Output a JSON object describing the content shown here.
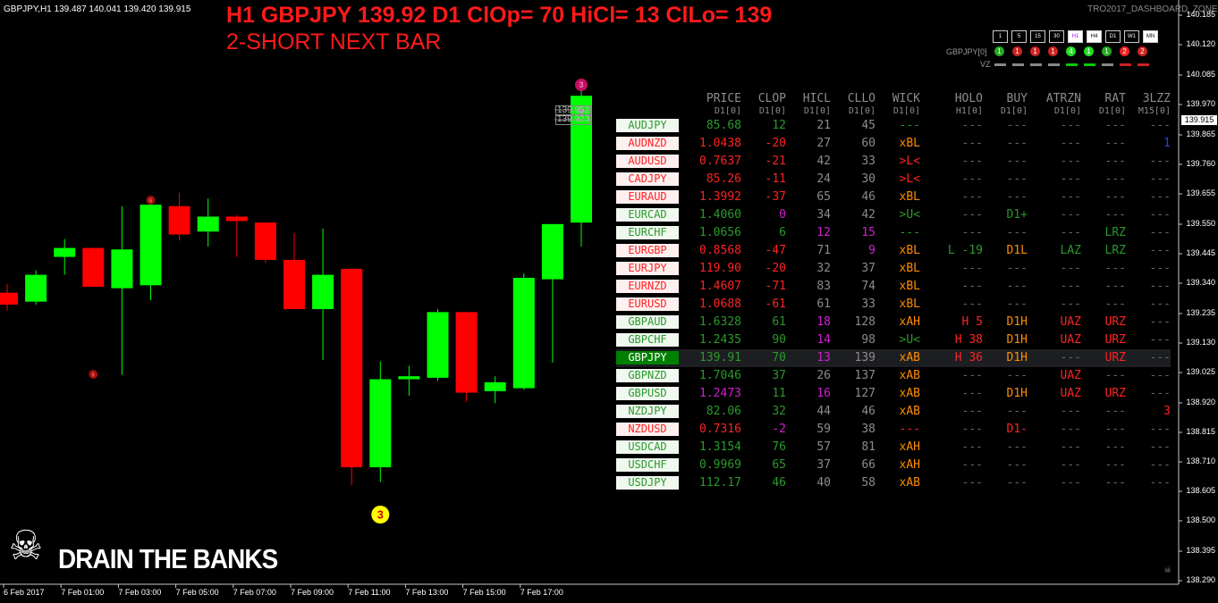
{
  "header": {
    "symbol_line": "GBPJPY,H1  139.487 140.041 139.420 139.915",
    "signal_line_1": "H1 GBPJPY 139.92  D1 ClOp= 70 HiCl= 13 ClLo= 139",
    "signal_line_2": "2-SHORT NEXT BAR",
    "dashboard_name": "TRO2017_DASHBOARD_ZONES"
  },
  "timeframes": [
    {
      "label": "1",
      "state": "normal"
    },
    {
      "label": "5",
      "state": "normal"
    },
    {
      "label": "15",
      "state": "normal"
    },
    {
      "label": "30",
      "state": "normal"
    },
    {
      "label": "H1",
      "state": "highlight"
    },
    {
      "label": "H4",
      "state": "active"
    },
    {
      "label": "D1",
      "state": "normal"
    },
    {
      "label": "W1",
      "state": "normal"
    },
    {
      "label": "MN",
      "state": "active"
    }
  ],
  "indicator_row": {
    "label": "GBPJPY[0]",
    "dots": [
      {
        "text": "1",
        "color": "#22aa22"
      },
      {
        "text": "1",
        "color": "#cc2222"
      },
      {
        "text": "1",
        "color": "#cc2222"
      },
      {
        "text": "1",
        "color": "#cc2222"
      },
      {
        "text": "4",
        "color": "#22dd22"
      },
      {
        "text": "1",
        "color": "#22dd22"
      },
      {
        "text": "1",
        "color": "#22aa22"
      },
      {
        "text": "2",
        "color": "#ee2222"
      },
      {
        "text": "2",
        "color": "#cc2222"
      }
    ]
  },
  "vz_row": {
    "label": "VZ",
    "bars": [
      "#888888",
      "#888888",
      "#888888",
      "#888888",
      "#00cc00",
      "#00cc00",
      "#888888",
      "#cc2222",
      "#cc2222"
    ]
  },
  "table": {
    "columns": [
      {
        "title": "PRICE",
        "sub": "D1[0]"
      },
      {
        "title": "CLOP",
        "sub": "D1[0]"
      },
      {
        "title": "HICL",
        "sub": "D1[0]"
      },
      {
        "title": "CLLO",
        "sub": "D1[0]"
      },
      {
        "title": "WICK",
        "sub": "D1[0]"
      },
      {
        "title": "HOLO",
        "sub": "H1[0]"
      },
      {
        "title": "BUY",
        "sub": "D1[0]"
      },
      {
        "title": "ATRZN",
        "sub": "D1[0]"
      },
      {
        "title": "RAT",
        "sub": "D1[0]"
      },
      {
        "title": "3LZZ",
        "sub": "M15[0]"
      }
    ],
    "rows": [
      {
        "sym": "AUDJPY",
        "dir": "up",
        "price": "85.68",
        "clop": "12",
        "hicl": "21",
        "cllo": "45",
        "wick": "---",
        "holo": "---",
        "buy": "---",
        "atrzn": "---",
        "rat": "---",
        "lzz": "---",
        "c": {
          "price": "#2a9a2a",
          "clop": "#2a9a2a",
          "hicl": "#8c8c8c",
          "cllo": "#8c8c8c",
          "wick": "#2a9a2a",
          "lzz": "#666"
        }
      },
      {
        "sym": "AUDNZD",
        "dir": "down",
        "price": "1.0438",
        "clop": "-20",
        "hicl": "27",
        "cllo": "60",
        "wick": "xBL",
        "holo": "---",
        "buy": "---",
        "atrzn": "---",
        "rat": "---",
        "lzz": "1",
        "c": {
          "price": "#ff2222",
          "clop": "#ff2222",
          "hicl": "#8c8c8c",
          "cllo": "#8c8c8c",
          "wick": "#ff8c00",
          "lzz": "#2244ff"
        }
      },
      {
        "sym": "AUDUSD",
        "dir": "down",
        "price": "0.7637",
        "clop": "-21",
        "hicl": "42",
        "cllo": "33",
        "wick": ">L<",
        "holo": "---",
        "buy": "---",
        "atrzn": "---",
        "rat": "---",
        "lzz": "---",
        "c": {
          "price": "#ff2222",
          "clop": "#ff2222",
          "hicl": "#8c8c8c",
          "cllo": "#8c8c8c",
          "wick": "#ff2222",
          "lzz": "#666"
        }
      },
      {
        "sym": "CADJPY",
        "dir": "down",
        "price": "85.26",
        "clop": "-11",
        "hicl": "24",
        "cllo": "30",
        "wick": ">L<",
        "holo": "---",
        "buy": "---",
        "atrzn": "---",
        "rat": "---",
        "lzz": "---",
        "c": {
          "price": "#ff2222",
          "clop": "#ff2222",
          "hicl": "#8c8c8c",
          "cllo": "#8c8c8c",
          "wick": "#ff2222",
          "lzz": "#666"
        }
      },
      {
        "sym": "EURAUD",
        "dir": "down",
        "price": "1.3992",
        "clop": "-37",
        "hicl": "65",
        "cllo": "46",
        "wick": "xBL",
        "holo": "---",
        "buy": "---",
        "atrzn": "---",
        "rat": "---",
        "lzz": "---",
        "c": {
          "price": "#ff2222",
          "clop": "#ff2222",
          "hicl": "#8c8c8c",
          "cllo": "#8c8c8c",
          "wick": "#ff8c00",
          "lzz": "#666"
        }
      },
      {
        "sym": "EURCAD",
        "dir": "up",
        "price": "1.4060",
        "clop": "0",
        "hicl": "34",
        "cllo": "42",
        "wick": ">U<",
        "holo": "---",
        "buy": "D1+",
        "atrzn": "---",
        "rat": "---",
        "lzz": "---",
        "c": {
          "price": "#2a9a2a",
          "clop": "#d020d0",
          "hicl": "#8c8c8c",
          "cllo": "#8c8c8c",
          "wick": "#2a9a2a",
          "buy": "#2a9a2a",
          "lzz": "#666"
        }
      },
      {
        "sym": "EURCHF",
        "dir": "up",
        "price": "1.0656",
        "clop": "6",
        "hicl": "12",
        "cllo": "15",
        "wick": "---",
        "holo": "---",
        "buy": "---",
        "atrzn": "---",
        "rat": "LRZ",
        "lzz": "---",
        "c": {
          "price": "#2a9a2a",
          "clop": "#2a9a2a",
          "hicl": "#d020d0",
          "cllo": "#d020d0",
          "wick": "#2a9a2a",
          "rat": "#2a9a2a",
          "lzz": "#666"
        }
      },
      {
        "sym": "EURGBP",
        "dir": "down",
        "price": "0.8568",
        "clop": "-47",
        "hicl": "71",
        "cllo": "9",
        "wick": "xBL",
        "holo": "L -19",
        "buy": "D1L",
        "atrzn": "LAZ",
        "rat": "LRZ",
        "lzz": "---",
        "c": {
          "price": "#ff2222",
          "clop": "#ff2222",
          "hicl": "#8c8c8c",
          "cllo": "#d020d0",
          "wick": "#ff8c00",
          "holo": "#2a9a2a",
          "buy": "#ff8c00",
          "atrzn": "#2a9a2a",
          "rat": "#2a9a2a",
          "lzz": "#666"
        }
      },
      {
        "sym": "EURJPY",
        "dir": "down",
        "price": "119.90",
        "clop": "-20",
        "hicl": "32",
        "cllo": "37",
        "wick": "xBL",
        "holo": "---",
        "buy": "---",
        "atrzn": "---",
        "rat": "---",
        "lzz": "---",
        "c": {
          "price": "#ff2222",
          "clop": "#ff2222",
          "hicl": "#8c8c8c",
          "cllo": "#8c8c8c",
          "wick": "#ff8c00",
          "lzz": "#666"
        }
      },
      {
        "sym": "EURNZD",
        "dir": "down",
        "price": "1.4607",
        "clop": "-71",
        "hicl": "83",
        "cllo": "74",
        "wick": "xBL",
        "holo": "---",
        "buy": "---",
        "atrzn": "---",
        "rat": "---",
        "lzz": "---",
        "c": {
          "price": "#ff2222",
          "clop": "#ff2222",
          "hicl": "#8c8c8c",
          "cllo": "#8c8c8c",
          "wick": "#ff8c00",
          "lzz": "#666"
        }
      },
      {
        "sym": "EURUSD",
        "dir": "down",
        "price": "1.0688",
        "clop": "-61",
        "hicl": "61",
        "cllo": "33",
        "wick": "xBL",
        "holo": "---",
        "buy": "---",
        "atrzn": "---",
        "rat": "---",
        "lzz": "---",
        "c": {
          "price": "#ff2222",
          "clop": "#ff2222",
          "hicl": "#8c8c8c",
          "cllo": "#8c8c8c",
          "wick": "#ff8c00",
          "lzz": "#666"
        }
      },
      {
        "sym": "GBPAUD",
        "dir": "up",
        "price": "1.6328",
        "clop": "61",
        "hicl": "18",
        "cllo": "128",
        "wick": "xAH",
        "holo": "H 5",
        "buy": "D1H",
        "atrzn": "UAZ",
        "rat": "URZ",
        "lzz": "---",
        "c": {
          "price": "#2a9a2a",
          "clop": "#2a9a2a",
          "hicl": "#d020d0",
          "cllo": "#8c8c8c",
          "wick": "#ff8c00",
          "holo": "#ff2222",
          "buy": "#ff8c00",
          "atrzn": "#ff2222",
          "rat": "#ff2222",
          "lzz": "#666"
        }
      },
      {
        "sym": "GBPCHF",
        "dir": "up",
        "price": "1.2435",
        "clop": "90",
        "hicl": "14",
        "cllo": "98",
        "wick": ">U<",
        "holo": "H 38",
        "buy": "D1H",
        "atrzn": "UAZ",
        "rat": "URZ",
        "lzz": "---",
        "c": {
          "price": "#2a9a2a",
          "clop": "#2a9a2a",
          "hicl": "#d020d0",
          "cllo": "#8c8c8c",
          "wick": "#2a9a2a",
          "holo": "#ff2222",
          "buy": "#ff8c00",
          "atrzn": "#ff2222",
          "rat": "#ff2222",
          "lzz": "#666"
        }
      },
      {
        "sym": "GBPJPY",
        "dir": "sel",
        "price": "139.91",
        "clop": "70",
        "hicl": "13",
        "cllo": "139",
        "wick": "xAB",
        "holo": "H 36",
        "buy": "D1H",
        "atrzn": "---",
        "rat": "URZ",
        "lzz": "---",
        "c": {
          "price": "#2a9a2a",
          "clop": "#2a9a2a",
          "hicl": "#d020d0",
          "cllo": "#8c8c8c",
          "wick": "#ff8c00",
          "holo": "#ff2222",
          "buy": "#ff8c00",
          "atrzn": "#666",
          "rat": "#ff2222",
          "lzz": "#666"
        }
      },
      {
        "sym": "GBPNZD",
        "dir": "up",
        "price": "1.7046",
        "clop": "37",
        "hicl": "26",
        "cllo": "137",
        "wick": "xAB",
        "holo": "---",
        "buy": "---",
        "atrzn": "UAZ",
        "rat": "---",
        "lzz": "---",
        "c": {
          "price": "#2a9a2a",
          "clop": "#2a9a2a",
          "hicl": "#8c8c8c",
          "cllo": "#8c8c8c",
          "wick": "#ff8c00",
          "atrzn": "#ff2222",
          "lzz": "#666"
        }
      },
      {
        "sym": "GBPUSD",
        "dir": "up",
        "price": "1.2473",
        "clop": "11",
        "hicl": "16",
        "cllo": "127",
        "wick": "xAB",
        "holo": "---",
        "buy": "D1H",
        "atrzn": "UAZ",
        "rat": "URZ",
        "lzz": "---",
        "c": {
          "price": "#d020d0",
          "clop": "#2a9a2a",
          "hicl": "#d020d0",
          "cllo": "#8c8c8c",
          "wick": "#ff8c00",
          "buy": "#ff8c00",
          "atrzn": "#ff2222",
          "rat": "#ff2222",
          "lzz": "#666"
        }
      },
      {
        "sym": "NZDJPY",
        "dir": "up",
        "price": "82.06",
        "clop": "32",
        "hicl": "44",
        "cllo": "46",
        "wick": "xAB",
        "holo": "---",
        "buy": "---",
        "atrzn": "---",
        "rat": "---",
        "lzz": "3",
        "c": {
          "price": "#2a9a2a",
          "clop": "#2a9a2a",
          "hicl": "#8c8c8c",
          "cllo": "#8c8c8c",
          "wick": "#ff8c00",
          "lzz": "#ff2222"
        }
      },
      {
        "sym": "NZDUSD",
        "dir": "down",
        "price": "0.7316",
        "clop": "-2",
        "hicl": "59",
        "cllo": "38",
        "wick": "---",
        "holo": "---",
        "buy": "D1-",
        "atrzn": "---",
        "rat": "---",
        "lzz": "---",
        "c": {
          "price": "#ff2222",
          "clop": "#d020d0",
          "hicl": "#8c8c8c",
          "cllo": "#8c8c8c",
          "wick": "#ff2222",
          "buy": "#ff2222",
          "lzz": "#666"
        }
      },
      {
        "sym": "USDCAD",
        "dir": "up",
        "price": "1.3154",
        "clop": "76",
        "hicl": "57",
        "cllo": "81",
        "wick": "xAH",
        "holo": "---",
        "buy": "---",
        "atrzn": "---",
        "rat": "---",
        "lzz": "---",
        "c": {
          "price": "#2a9a2a",
          "clop": "#2a9a2a",
          "hicl": "#8c8c8c",
          "cllo": "#8c8c8c",
          "wick": "#ff8c00",
          "lzz": "#666"
        }
      },
      {
        "sym": "USDCHF",
        "dir": "up",
        "price": "0.9969",
        "clop": "65",
        "hicl": "37",
        "cllo": "66",
        "wick": "xAH",
        "holo": "---",
        "buy": "---",
        "atrzn": "---",
        "rat": "---",
        "lzz": "---",
        "c": {
          "price": "#2a9a2a",
          "clop": "#2a9a2a",
          "hicl": "#8c8c8c",
          "cllo": "#8c8c8c",
          "wick": "#ff8c00",
          "lzz": "#666"
        }
      },
      {
        "sym": "USDJPY",
        "dir": "up",
        "price": "112.17",
        "clop": "46",
        "hicl": "40",
        "cllo": "58",
        "wick": "xAB",
        "holo": "---",
        "buy": "---",
        "atrzn": "---",
        "rat": "---",
        "lzz": "---",
        "c": {
          "price": "#2a9a2a",
          "clop": "#2a9a2a",
          "hicl": "#8c8c8c",
          "cllo": "#8c8c8c",
          "wick": "#ff8c00",
          "lzz": "#666"
        }
      }
    ]
  },
  "price_axis": {
    "labels": [
      "140.185",
      "140.120",
      "140.085",
      "139.970",
      "139.915",
      "139.865",
      "139.760",
      "139.655",
      "139.550",
      "139.445",
      "139.340",
      "139.235",
      "139.130",
      "139.025",
      "138.920",
      "138.815",
      "138.710",
      "138.605",
      "138.500",
      "138.395",
      "138.290"
    ],
    "current": "139.915"
  },
  "time_axis": {
    "labels": [
      "6 Feb 2017",
      "7 Feb 01:00",
      "7 Feb 03:00",
      "7 Feb 05:00",
      "7 Feb 07:00",
      "7 Feb 09:00",
      "7 Feb 11:00",
      "7 Feb 13:00",
      "7 Feb 15:00",
      "7 Feb 17:00"
    ]
  },
  "chart_annotations": {
    "price_tag_1": "139.952",
    "price_tag_2": "139.923",
    "marker_number": "3",
    "top_marker": "3",
    "high_marker": "6",
    "low_marker": "6"
  },
  "branding": {
    "slogan": "DRAIN THE BANKS",
    "skull": "☠"
  },
  "chart_data": {
    "type": "candlestick",
    "symbol": "GBPJPY",
    "timeframe": "H1",
    "candles": [
      {
        "o": 139.255,
        "h": 139.285,
        "l": 139.195,
        "c": 139.215
      },
      {
        "o": 139.225,
        "h": 139.33,
        "l": 139.215,
        "c": 139.315
      },
      {
        "o": 139.375,
        "h": 139.435,
        "l": 139.315,
        "c": 139.405
      },
      {
        "o": 139.405,
        "h": 139.405,
        "l": 139.29,
        "c": 139.275
      },
      {
        "o": 139.27,
        "h": 139.545,
        "l": 138.98,
        "c": 139.4
      },
      {
        "o": 139.28,
        "h": 139.545,
        "l": 139.23,
        "c": 139.55
      },
      {
        "o": 139.545,
        "h": 139.59,
        "l": 139.43,
        "c": 139.45
      },
      {
        "o": 139.46,
        "h": 139.57,
        "l": 139.41,
        "c": 139.51
      },
      {
        "o": 139.51,
        "h": 139.515,
        "l": 139.375,
        "c": 139.495
      },
      {
        "o": 139.49,
        "h": 139.49,
        "l": 139.355,
        "c": 139.365
      },
      {
        "o": 139.365,
        "h": 139.455,
        "l": 139.205,
        "c": 139.2
      },
      {
        "o": 139.2,
        "h": 139.47,
        "l": 139.03,
        "c": 139.315
      },
      {
        "o": 139.335,
        "h": 139.335,
        "l": 138.61,
        "c": 138.67
      },
      {
        "o": 138.67,
        "h": 139.025,
        "l": 138.62,
        "c": 138.965
      },
      {
        "o": 138.965,
        "h": 139.01,
        "l": 138.91,
        "c": 138.975
      },
      {
        "o": 138.97,
        "h": 139.2,
        "l": 138.96,
        "c": 139.19
      },
      {
        "o": 139.19,
        "h": 139.19,
        "l": 138.89,
        "c": 138.92
      },
      {
        "o": 138.925,
        "h": 138.975,
        "l": 138.885,
        "c": 138.955
      },
      {
        "o": 138.935,
        "h": 139.32,
        "l": 138.93,
        "c": 139.305
      },
      {
        "o": 139.3,
        "h": 139.48,
        "l": 139.02,
        "c": 139.485
      },
      {
        "o": 139.49,
        "h": 139.95,
        "l": 139.41,
        "c": 139.915
      }
    ]
  }
}
